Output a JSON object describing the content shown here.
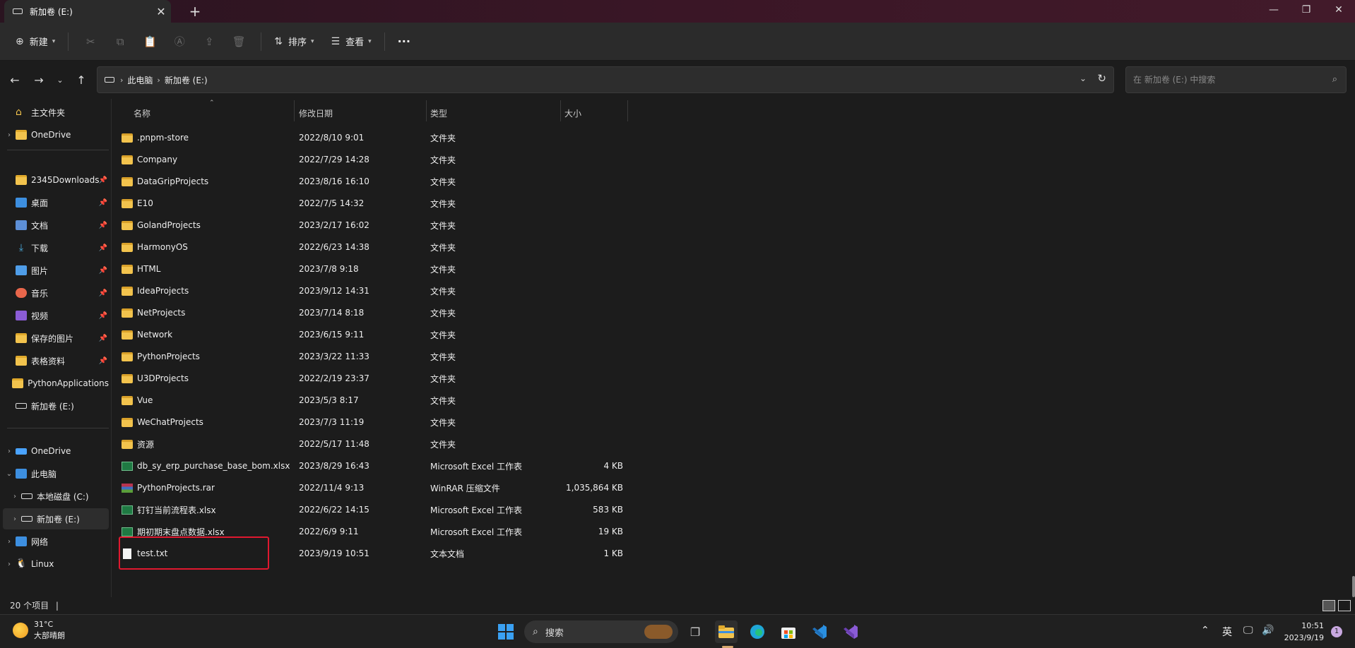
{
  "window": {
    "tab_title": "新加卷 (E:)",
    "tab_close": "✕",
    "new_tab": "+",
    "min": "—",
    "max": "❐",
    "close": "✕"
  },
  "toolbar": {
    "new_label": "新建",
    "sort_label": "排序",
    "view_label": "查看",
    "more": "···"
  },
  "address": {
    "crumbs": [
      "此电脑",
      "新加卷 (E:)"
    ],
    "search_placeholder": "在 新加卷 (E:) 中搜索"
  },
  "sidebar": {
    "items": [
      {
        "label": "主文件夹",
        "icon": "home-icon"
      },
      {
        "label": "OneDrive",
        "icon": "folder-icon"
      },
      {
        "label": "2345Downloads",
        "icon": "folder-icon",
        "pinned": true
      },
      {
        "label": "桌面",
        "icon": "desktop-icon",
        "pinned": true
      },
      {
        "label": "文档",
        "icon": "document-icon",
        "pinned": true
      },
      {
        "label": "下载",
        "icon": "download-icon",
        "pinned": true
      },
      {
        "label": "图片",
        "icon": "picture-icon",
        "pinned": true
      },
      {
        "label": "音乐",
        "icon": "music-icon",
        "pinned": true
      },
      {
        "label": "视频",
        "icon": "video-icon",
        "pinned": true
      },
      {
        "label": "保存的图片",
        "icon": "folder-icon",
        "pinned": true
      },
      {
        "label": "表格资料",
        "icon": "folder-icon",
        "pinned": true
      },
      {
        "label": "PythonApplications",
        "icon": "folder-icon"
      },
      {
        "label": "新加卷 (E:)",
        "icon": "drive-icon"
      },
      {
        "label": "OneDrive",
        "icon": "cloud-icon"
      },
      {
        "label": "此电脑",
        "icon": "pc-icon"
      },
      {
        "label": "本地磁盘 (C:)",
        "icon": "disk-icon"
      },
      {
        "label": "新加卷 (E:)",
        "icon": "drive-icon"
      },
      {
        "label": "网络",
        "icon": "network-icon"
      },
      {
        "label": "Linux",
        "icon": "linux-icon"
      }
    ]
  },
  "columns": {
    "name": "名称",
    "date": "修改日期",
    "type": "类型",
    "size": "大小"
  },
  "files": [
    {
      "name": ".pnpm-store",
      "date": "2022/8/10 9:01",
      "type": "文件夹",
      "size": "",
      "kind": "folder"
    },
    {
      "name": "Company",
      "date": "2022/7/29 14:28",
      "type": "文件夹",
      "size": "",
      "kind": "folder"
    },
    {
      "name": "DataGripProjects",
      "date": "2023/8/16 16:10",
      "type": "文件夹",
      "size": "",
      "kind": "folder"
    },
    {
      "name": "E10",
      "date": "2022/7/5 14:32",
      "type": "文件夹",
      "size": "",
      "kind": "folder"
    },
    {
      "name": "GolandProjects",
      "date": "2023/2/17 16:02",
      "type": "文件夹",
      "size": "",
      "kind": "folder"
    },
    {
      "name": "HarmonyOS",
      "date": "2022/6/23 14:38",
      "type": "文件夹",
      "size": "",
      "kind": "folder"
    },
    {
      "name": "HTML",
      "date": "2023/7/8 9:18",
      "type": "文件夹",
      "size": "",
      "kind": "folder"
    },
    {
      "name": "IdeaProjects",
      "date": "2023/9/12 14:31",
      "type": "文件夹",
      "size": "",
      "kind": "folder"
    },
    {
      "name": "NetProjects",
      "date": "2023/7/14 8:18",
      "type": "文件夹",
      "size": "",
      "kind": "folder"
    },
    {
      "name": "Network",
      "date": "2023/6/15 9:11",
      "type": "文件夹",
      "size": "",
      "kind": "folder"
    },
    {
      "name": "PythonProjects",
      "date": "2023/3/22 11:33",
      "type": "文件夹",
      "size": "",
      "kind": "folder"
    },
    {
      "name": "U3DProjects",
      "date": "2022/2/19 23:37",
      "type": "文件夹",
      "size": "",
      "kind": "folder"
    },
    {
      "name": "Vue",
      "date": "2023/5/3 8:17",
      "type": "文件夹",
      "size": "",
      "kind": "folder"
    },
    {
      "name": "WeChatProjects",
      "date": "2023/7/3 11:19",
      "type": "文件夹",
      "size": "",
      "kind": "folder"
    },
    {
      "name": "资源",
      "date": "2022/5/17 11:48",
      "type": "文件夹",
      "size": "",
      "kind": "folder"
    },
    {
      "name": "db_sy_erp_purchase_base_bom.xlsx",
      "date": "2023/8/29 16:43",
      "type": "Microsoft Excel 工作表",
      "size": "4 KB",
      "kind": "xlsx"
    },
    {
      "name": "PythonProjects.rar",
      "date": "2022/11/4 9:13",
      "type": "WinRAR 压缩文件",
      "size": "1,035,864 KB",
      "kind": "rar"
    },
    {
      "name": "钉钉当前流程表.xlsx",
      "date": "2022/6/22 14:15",
      "type": "Microsoft Excel 工作表",
      "size": "583 KB",
      "kind": "xlsx"
    },
    {
      "name": "期初期末盘点数据.xlsx",
      "date": "2022/6/9 9:11",
      "type": "Microsoft Excel 工作表",
      "size": "19 KB",
      "kind": "xlsx"
    },
    {
      "name": "test.txt",
      "date": "2023/9/19 10:51",
      "type": "文本文档",
      "size": "1 KB",
      "kind": "txt"
    }
  ],
  "status": {
    "count": "20 个项目"
  },
  "taskbar": {
    "temp": "31°C",
    "weather": "大部晴朗",
    "search": "搜索",
    "ime": "英",
    "time": "10:51",
    "date": "2023/9/19",
    "notif": "1"
  }
}
